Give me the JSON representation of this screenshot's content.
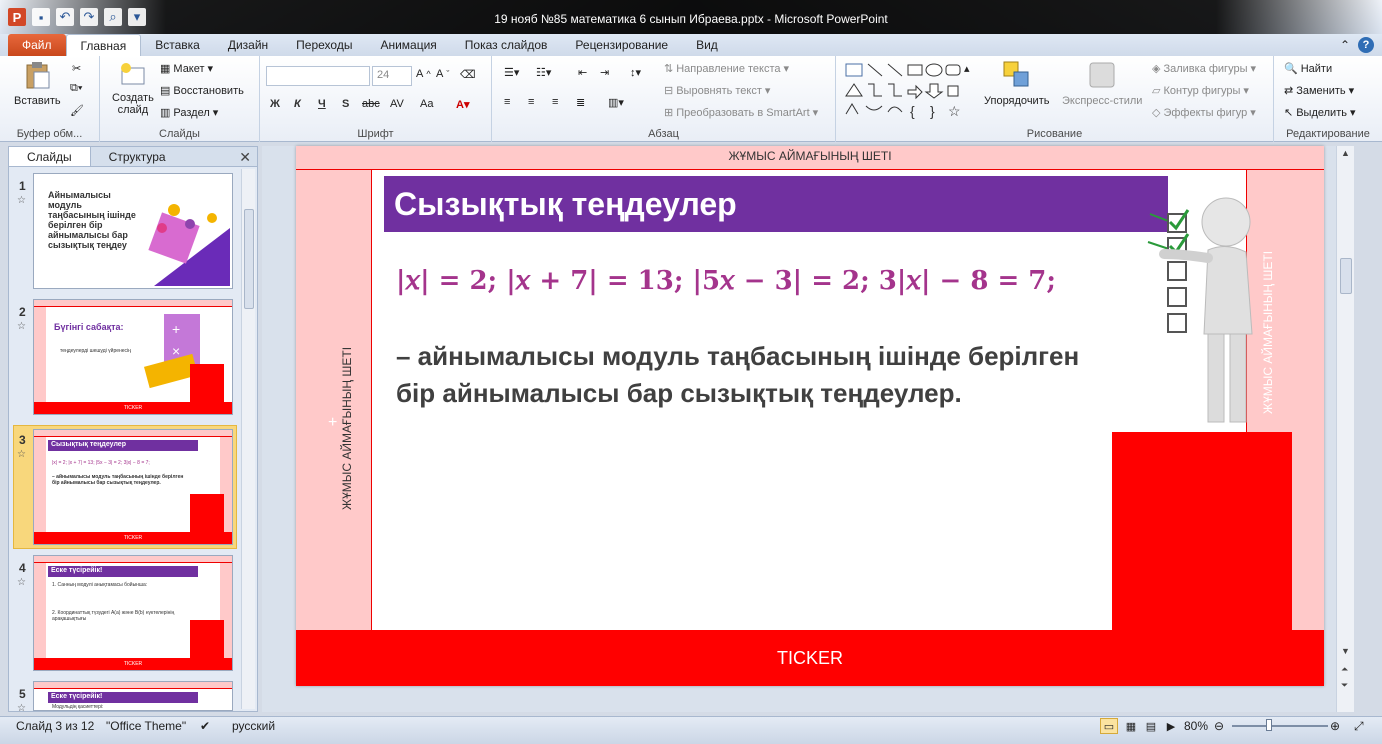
{
  "window": {
    "title": "19 нояб №85 математика 6 сынып Ибраева.pptx  -  Microsoft PowerPoint"
  },
  "tabs": [
    "Файл",
    "Главная",
    "Вставка",
    "Дизайн",
    "Переходы",
    "Анимация",
    "Показ слайдов",
    "Рецензирование",
    "Вид"
  ],
  "ribbon": {
    "clipboard": {
      "label": "Буфер обм...",
      "paste": "Вставить"
    },
    "slides": {
      "label": "Слайды",
      "create": "Создать",
      "create2": "слайд",
      "layout": "Макет",
      "reset": "Восстановить",
      "section": "Раздел"
    },
    "font": {
      "label": "Шрифт",
      "size": "24",
      "bold": "Ж",
      "italic": "К",
      "underline": "Ч",
      "shadow": "S",
      "strike": "abc",
      "spacing": "AV",
      "case": "Aa"
    },
    "paragraph": {
      "label": "Абзац",
      "text_dir": "Направление текста",
      "align_text": "Выровнять текст",
      "smartart": "Преобразовать в SmartArt"
    },
    "drawing": {
      "label": "Рисование",
      "arrange": "Упорядочить",
      "quick_styles": "Экспресс-стили",
      "fill": "Заливка фигуры",
      "outline": "Контур фигуры",
      "effects": "Эффекты фигур"
    },
    "editing": {
      "label": "Редактирование",
      "find": "Найти",
      "replace": "Заменить",
      "select": "Выделить"
    }
  },
  "panel": {
    "tabs": [
      "Слайды",
      "Структура"
    ],
    "thumbs": [
      {
        "num": "1",
        "text": "Айнымалысы модуль таңбасының ішінде берілген бір айнымалысы бар сызықтық теңдеу"
      },
      {
        "num": "2",
        "title": "Бүгінгі сабақта:",
        "line": "теңдеулерді шешуді үйренесің",
        "ticker": "TICKER"
      },
      {
        "num": "3",
        "title": "Сызықтық теңдеулер",
        "eq": "|x| = 2;   |x + 7| = 13;   |5x − 3| = 2;   3|x| − 8 = 7;",
        "line": "– айнымалысы модуль таңбасының ішінде берілген бір айнымалысы бар сызықтық теңдеулер.",
        "ticker": "TICKER"
      },
      {
        "num": "4",
        "title": "Еске түсірейік!",
        "line1": "1. Санның модулі анықтамасы бойынша:",
        "line2": "2. Координаттық түзудегі A(a) және B(b) нүктелерінің арақашықтығы",
        "ticker": "TICKER"
      },
      {
        "num": "5",
        "title": "Еске түсірейік!",
        "line1": "Модульдің қасиеттері:"
      }
    ]
  },
  "slide": {
    "top_band": "ЖҰМЫС АЙМАҒЫНЫҢ ШЕТІ",
    "left_band": "ЖҰМЫС АЙМАҒЫНЫҢ ШЕТІ",
    "right_band": "ЖҰМЫС АЙМАҒЫНЫҢ ШЕТІ",
    "plus": "+",
    "title": "Сызықтық теңдеулер",
    "equations": "|𝑥| = 𝟐;    |𝑥 + 𝟕| = 𝟏𝟑;    |𝟓𝑥 − 𝟑| = 𝟐;    𝟑|𝑥| − 𝟖 = 𝟕;",
    "body": " – айнымалысы модуль таңбасының ішінде берілген бір айнымалысы бар сызықтық теңдеулер.",
    "ticker": "TICKER"
  },
  "status": {
    "slide": "Слайд 3 из 12",
    "theme": "\"Office Theme\"",
    "lang": "русский",
    "zoom": "80%"
  },
  "colors": {
    "accent_purple": "#7030a0",
    "red": "#ff0000",
    "pink_band": "#ffc9c9",
    "equation": "#a4348c"
  }
}
